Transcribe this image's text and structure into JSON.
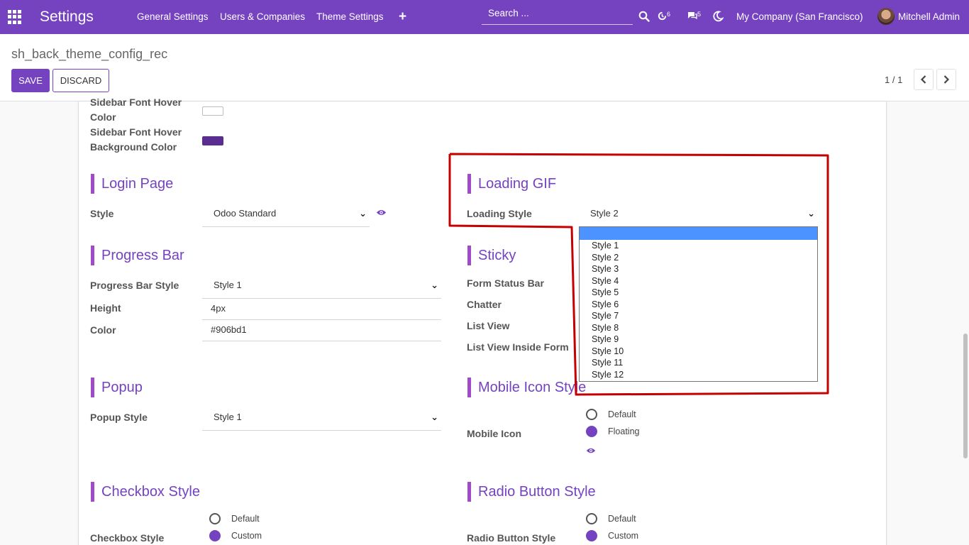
{
  "navbar": {
    "app_title": "Settings",
    "menu": [
      "General Settings",
      "Users & Companies",
      "Theme Settings"
    ],
    "add_symbol": "+",
    "search_placeholder": "Search ...",
    "activity_count": "6",
    "messages_count": "5",
    "company": "My Company (San Francisco)",
    "user": "Mitchell Admin"
  },
  "control_panel": {
    "breadcrumb": "sh_back_theme_config_rec",
    "save_label": "SAVE",
    "discard_label": "DISCARD",
    "pager": "1 / 1"
  },
  "sidebar_fields": {
    "hover_color_label": "Sidebar Font Hover Color",
    "hover_bg_label": "Sidebar Font Hover Background Color",
    "hover_color_value": "#ffffff",
    "hover_bg_value": "#5a2d91"
  },
  "login_page": {
    "heading": "Login Page",
    "style_label": "Style",
    "style_value": "Odoo Standard"
  },
  "loading_gif": {
    "heading": "Loading GIF",
    "style_label": "Loading Style",
    "style_value": "Style 2",
    "options": [
      "",
      "Style 1",
      "Style 2",
      "Style 3",
      "Style 4",
      "Style 5",
      "Style 6",
      "Style 7",
      "Style 8",
      "Style 9",
      "Style 10",
      "Style 11",
      "Style 12"
    ]
  },
  "progress_bar": {
    "heading": "Progress Bar",
    "style_label": "Progress Bar Style",
    "style_value": "Style 1",
    "height_label": "Height",
    "height_value": "4px",
    "color_label": "Color",
    "color_value": "#906bd1"
  },
  "sticky": {
    "heading": "Sticky",
    "labels": [
      "Form Status Bar",
      "Chatter",
      "List View",
      "List View Inside Form"
    ]
  },
  "popup": {
    "heading": "Popup",
    "style_label": "Popup Style",
    "style_value": "Style 1"
  },
  "mobile_icon": {
    "heading": "Mobile Icon Style",
    "label": "Mobile Icon",
    "option_default": "Default",
    "option_floating": "Floating",
    "selected": "Floating"
  },
  "checkbox_style": {
    "heading": "Checkbox Style",
    "label": "Checkbox Style",
    "option_default": "Default",
    "option_custom": "Custom",
    "selected": "Custom"
  },
  "radio_style": {
    "heading": "Radio Button Style",
    "label": "Radio Button Style",
    "option_default": "Default",
    "option_custom": "Custom",
    "selected": "Custom"
  },
  "colors": {
    "brand": "#7542c0",
    "annotation": "#c40000",
    "selection": "#4c93ff"
  }
}
